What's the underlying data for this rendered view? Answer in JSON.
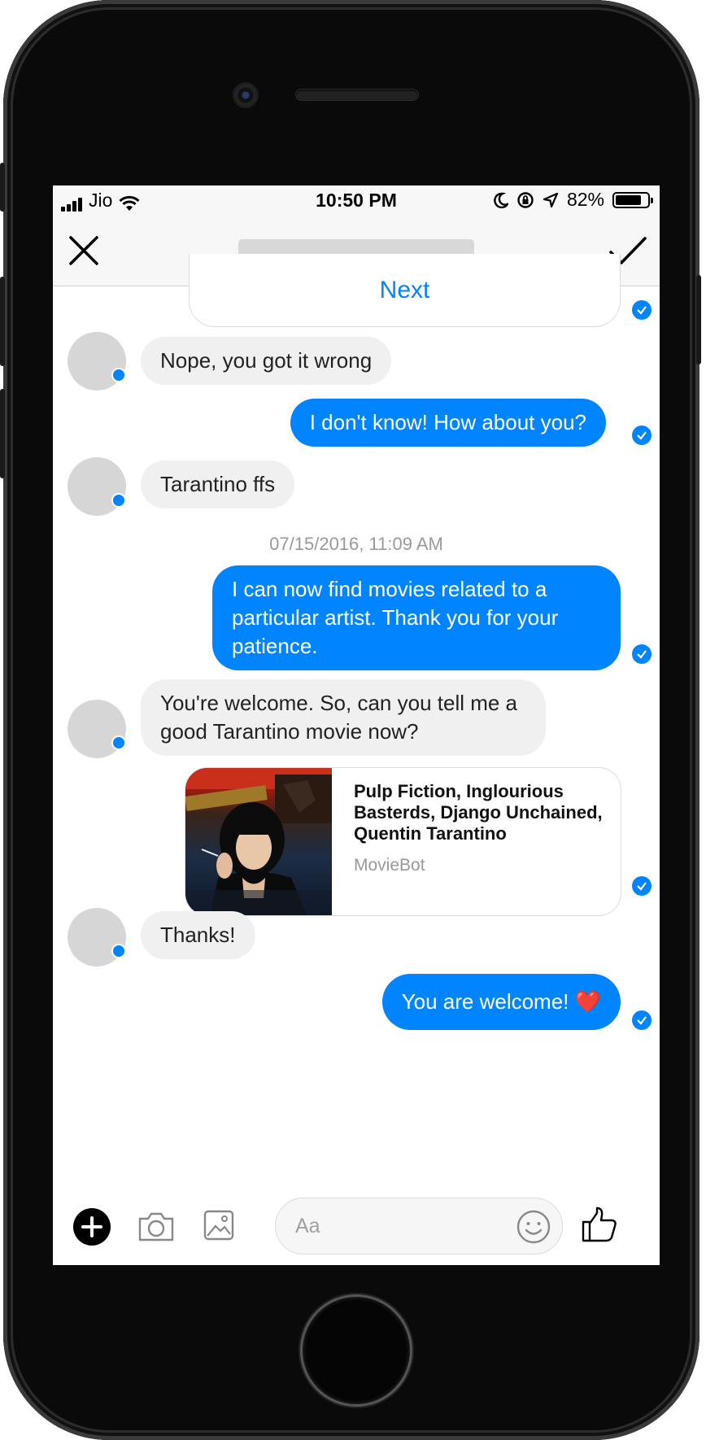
{
  "status_bar": {
    "carrier": "Jio",
    "time": "10:50 PM",
    "battery": "82%",
    "battery_level": 0.82
  },
  "nav": {
    "close_icon": "close-icon",
    "done_icon": "checkmark-icon"
  },
  "conversation": {
    "next_button": "Next",
    "msg_nope": "Nope, you got it wrong",
    "msg_dont_know": "I don't know! How about you?",
    "msg_tarantino": "Tarantino ffs",
    "timestamp": "07/15/2016, 11:09 AM",
    "msg_find_movies": "I can now find movies related to a particular artist. Thank you for your patience.",
    "msg_welcome_q": "You're welcome. So, can you tell me a good Tarantino movie now?",
    "movie_card": {
      "title": "Pulp Fiction, Inglourious Basterds, Django Unchained, Quentin Tarantino",
      "source": "MovieBot"
    },
    "msg_thanks": "Thanks!",
    "msg_you_are_welcome": "You are welcome! ❤️"
  },
  "composer": {
    "placeholder": "Aa",
    "icons": [
      "plus-icon",
      "camera-icon",
      "image-icon",
      "emoji-icon",
      "thumbs-up-icon"
    ]
  },
  "colors": {
    "accent": "#0084ff",
    "incoming_bubble": "#f0f0f0",
    "timestamp": "#9a9a9a"
  }
}
